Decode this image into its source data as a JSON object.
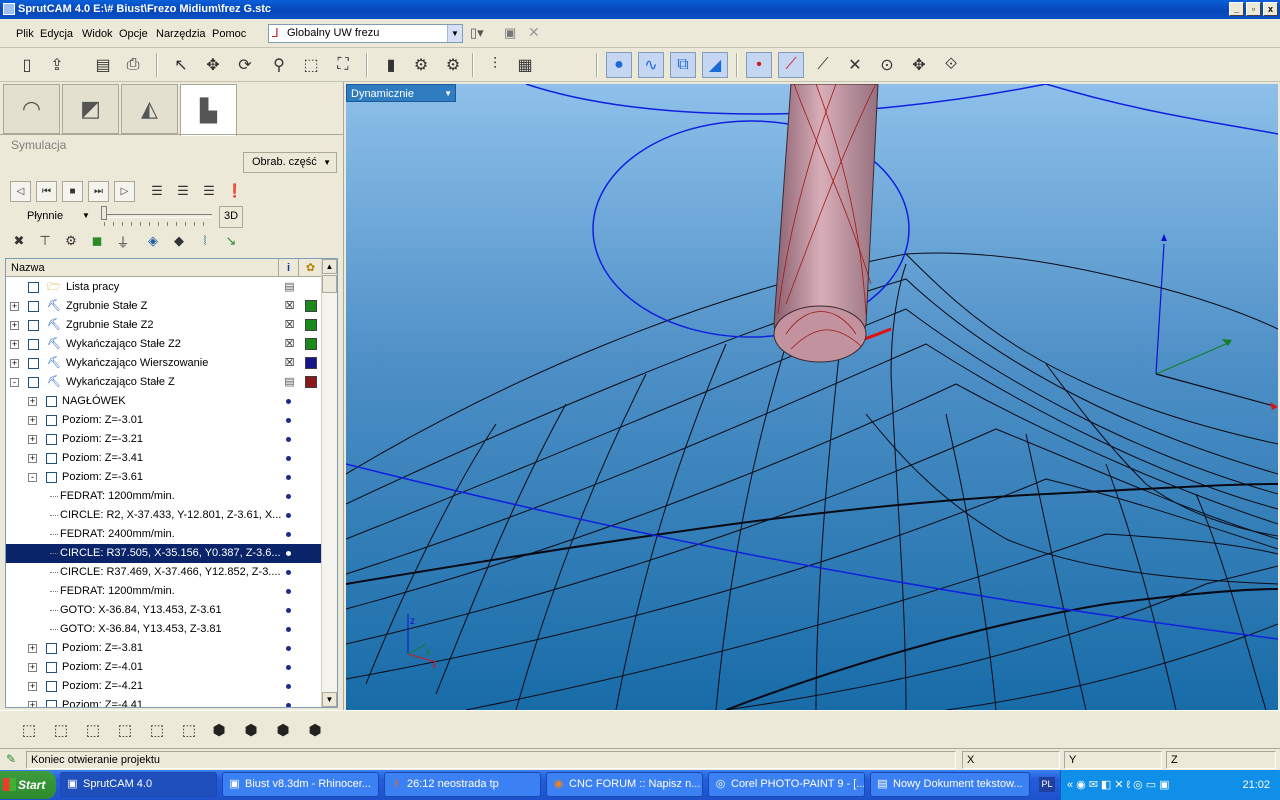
{
  "window": {
    "title": "SprutCAM 4.0 E:\\# Biust\\Frezo Midium\\frez G.stc",
    "controls": [
      "_",
      "▫",
      "x"
    ]
  },
  "menu": {
    "items": [
      "Plik",
      "Edycja",
      "Widok",
      "Opcje",
      "Narzędzia",
      "Pomoc"
    ],
    "coord_system": "Globalny UW frezu"
  },
  "panel": {
    "section": "Symulacja",
    "mode_button": "Obrab. część",
    "speed": "Płynnie",
    "toggle_3d": "3D",
    "tree_header": "Nazwa",
    "info_header": "i",
    "rows": [
      {
        "level": 0,
        "expander": "",
        "icon": "folder",
        "label": "Lista pracy",
        "mark": "doc",
        "color": ""
      },
      {
        "level": 0,
        "expander": "+",
        "icon": "op",
        "label": "Zgrubnie Stałe Z",
        "mark": "x",
        "color": "#1a8a1a"
      },
      {
        "level": 0,
        "expander": "+",
        "icon": "op",
        "label": "Zgrubnie Stałe Z2",
        "mark": "x",
        "color": "#1a8a1a"
      },
      {
        "level": 0,
        "expander": "+",
        "icon": "op",
        "label": "Wykańczająco Stałe Z2",
        "mark": "x",
        "color": "#1a8a1a"
      },
      {
        "level": 0,
        "expander": "+",
        "icon": "op",
        "label": "Wykańczająco Wierszowanie",
        "mark": "x",
        "color": "#16168a"
      },
      {
        "level": 0,
        "expander": "-",
        "icon": "op",
        "label": "Wykańczająco Stałe Z",
        "mark": "doc",
        "color": "#8a1a1a"
      },
      {
        "level": 1,
        "expander": "+",
        "icon": "",
        "label": "NAGŁÓWEK",
        "mark": "dot",
        "color": ""
      },
      {
        "level": 1,
        "expander": "+",
        "icon": "",
        "label": "Poziom: Z=-3.01",
        "mark": "dot",
        "color": ""
      },
      {
        "level": 1,
        "expander": "+",
        "icon": "",
        "label": "Poziom: Z=-3.21",
        "mark": "dot",
        "color": ""
      },
      {
        "level": 1,
        "expander": "+",
        "icon": "",
        "label": "Poziom: Z=-3.41",
        "mark": "dot",
        "color": ""
      },
      {
        "level": 1,
        "expander": "-",
        "icon": "",
        "label": "Poziom: Z=-3.61",
        "mark": "dot",
        "color": ""
      },
      {
        "level": 2,
        "expander": "",
        "icon": "",
        "label": "FEDRAT: 1200mm/min.",
        "mark": "dot",
        "color": ""
      },
      {
        "level": 2,
        "expander": "",
        "icon": "",
        "label": "CIRCLE: R2, X-37.433, Y-12.801, Z-3.61, X...",
        "mark": "dot",
        "color": ""
      },
      {
        "level": 2,
        "expander": "",
        "icon": "",
        "label": "FEDRAT: 2400mm/min.",
        "mark": "dot",
        "color": ""
      },
      {
        "level": 2,
        "expander": "",
        "icon": "",
        "label": "CIRCLE: R37.505, X-35.156, Y0.387, Z-3.6...",
        "mark": "dot",
        "color": "",
        "selected": true
      },
      {
        "level": 2,
        "expander": "",
        "icon": "",
        "label": "CIRCLE: R37.469, X-37.466, Y12.852, Z-3....",
        "mark": "dot",
        "color": ""
      },
      {
        "level": 2,
        "expander": "",
        "icon": "",
        "label": "FEDRAT: 1200mm/min.",
        "mark": "dot",
        "color": ""
      },
      {
        "level": 2,
        "expander": "",
        "icon": "",
        "label": "GOTO: X-36.84, Y13.453, Z-3.61",
        "mark": "dot",
        "color": ""
      },
      {
        "level": 2,
        "expander": "",
        "icon": "",
        "label": "GOTO: X-36.84, Y13.453, Z-3.81",
        "mark": "dot",
        "color": ""
      },
      {
        "level": 1,
        "expander": "+",
        "icon": "",
        "label": "Poziom: Z=-3.81",
        "mark": "dot",
        "color": ""
      },
      {
        "level": 1,
        "expander": "+",
        "icon": "",
        "label": "Poziom: Z=-4.01",
        "mark": "dot",
        "color": ""
      },
      {
        "level": 1,
        "expander": "+",
        "icon": "",
        "label": "Poziom: Z=-4.21",
        "mark": "dot",
        "color": ""
      },
      {
        "level": 1,
        "expander": "+",
        "icon": "",
        "label": "Poziom: Z=-4.41",
        "mark": "dot",
        "color": ""
      }
    ]
  },
  "viewport": {
    "view_mode": "Dynamicznie",
    "axis_labels": {
      "x": "x",
      "y": "y",
      "z": "z"
    }
  },
  "status": {
    "message": "Koniec otwieranie projektu",
    "x_label": "X",
    "y_label": "Y",
    "z_label": "Z"
  },
  "taskbar": {
    "start": "Start",
    "tasks": [
      {
        "label": "SprutCAM 4.0",
        "active": true
      },
      {
        "label": "Biust v8.3dm - Rhinocer...",
        "active": false
      },
      {
        "label": "26:12 neostrada tp",
        "active": false
      },
      {
        "label": "CNC FORUM :: Napisz n...",
        "active": false
      },
      {
        "label": "Corel PHOTO-PAINT 9 - [...",
        "active": false
      },
      {
        "label": "Nowy Dokument tekstow...",
        "active": false
      }
    ],
    "lang": "PL",
    "clock": "21:02"
  }
}
